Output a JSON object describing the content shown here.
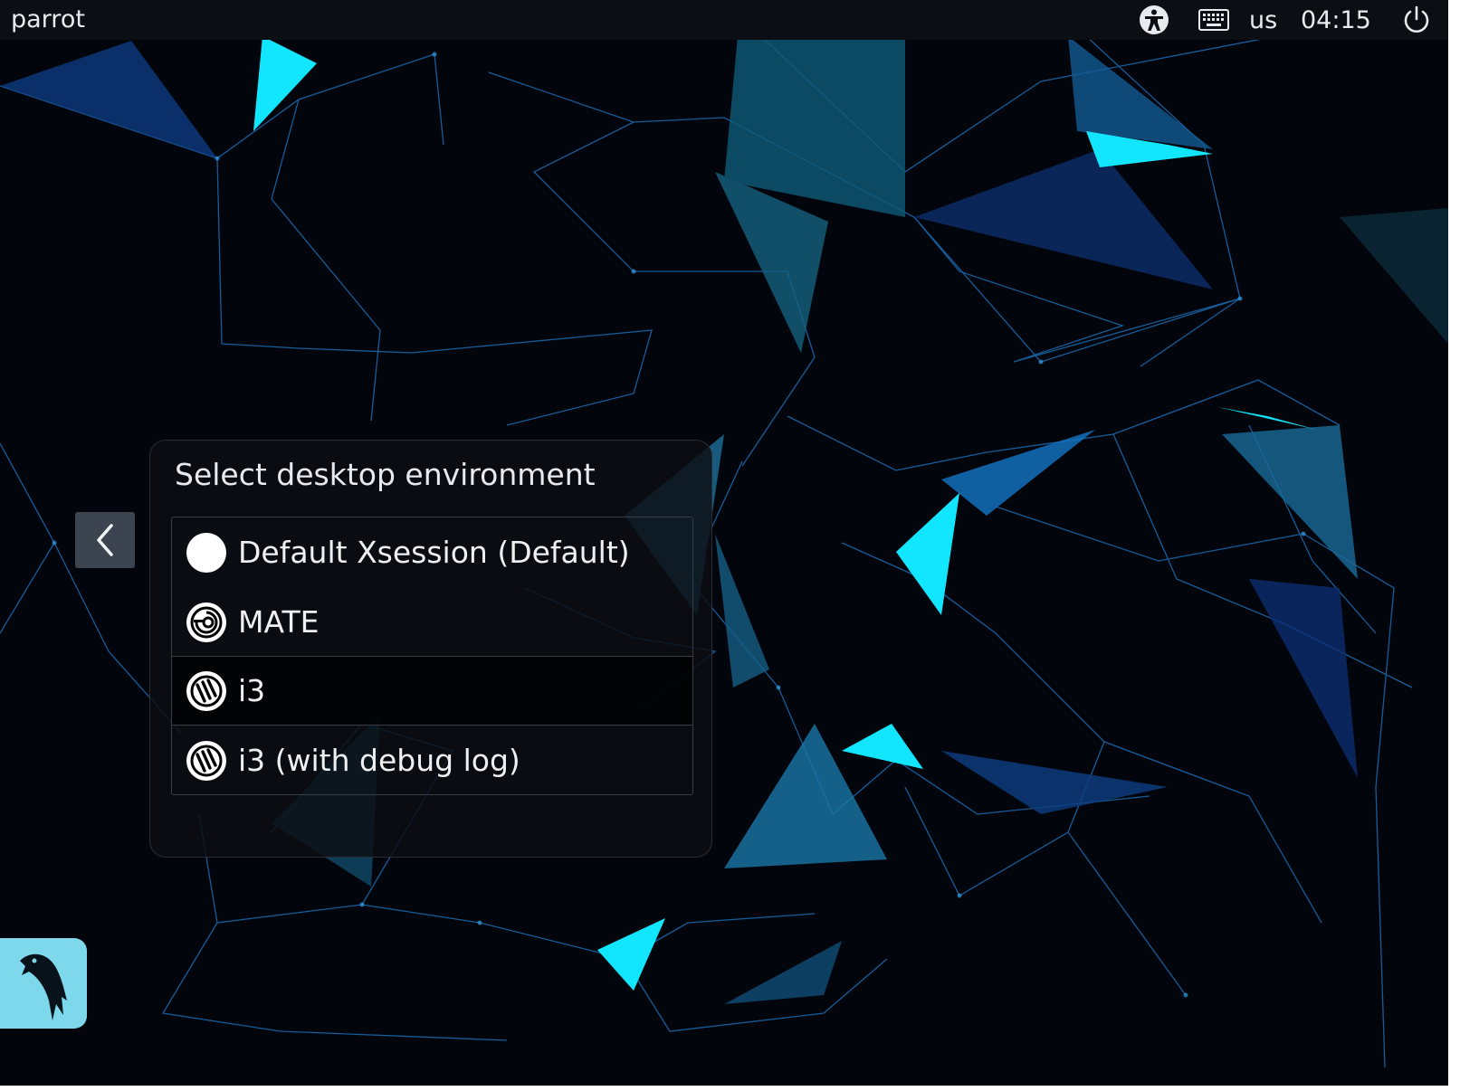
{
  "topbar": {
    "hostname": "parrot",
    "keyboard_layout": "us",
    "clock": "04:15",
    "accessibility_icon": "accessibility-icon",
    "keyboard_icon": "keyboard-icon",
    "power_icon": "power-icon"
  },
  "session_panel": {
    "title": "Select desktop environment",
    "items": [
      {
        "label": "Default Xsession (Default)",
        "icon": "circle-icon",
        "selected": false
      },
      {
        "label": "MATE",
        "icon": "mate-icon",
        "selected": false
      },
      {
        "label": "i3",
        "icon": "i3-icon",
        "selected": true
      },
      {
        "label": "i3 (with debug log)",
        "icon": "i3-icon",
        "selected": false
      }
    ]
  },
  "back_button": {
    "icon": "chevron-left-icon"
  },
  "logo": {
    "icon": "parrot-logo-icon"
  },
  "colors": {
    "background": "#02060c",
    "topbar": "#0b0f14",
    "accent_cyan": "#12e6ff",
    "logo_bg": "#7dd8ec",
    "back_button": "#3c444f"
  }
}
